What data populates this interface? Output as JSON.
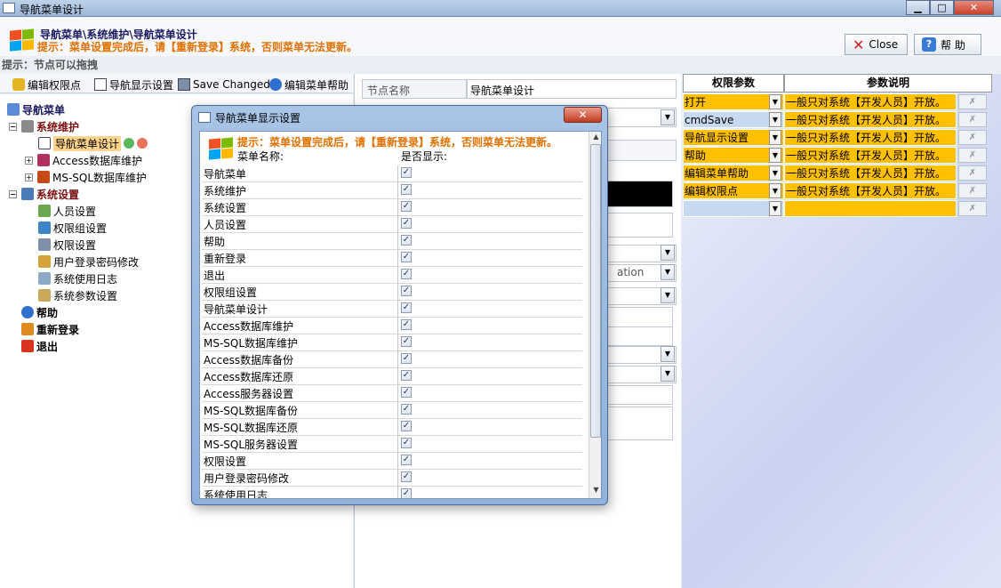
{
  "window": {
    "title": "导航菜单设计",
    "min": "▁",
    "max": "□",
    "close": "✕"
  },
  "header": {
    "path": "导航菜单\\系统维护\\导航菜单设计",
    "note": "提示：菜单设置完成后，请【重新登录】系统，否则菜单无法更新。",
    "close_label": "Close",
    "help_label": "帮  助"
  },
  "hint": "提示：节点可以拖拽",
  "toolbar": {
    "edit_perm": "编辑权限点",
    "nav_display": "导航显示设置",
    "save_changed": "Save Changed",
    "edit_help": "编辑菜单帮助"
  },
  "tree": {
    "root": "导航菜单",
    "sys_maint": "系统维护",
    "nav_design": "导航菜单设计",
    "access_maint": "Access数据库维护",
    "mssql_maint": "MS-SQL数据库维护",
    "sys_settings": "系统设置",
    "user_settings": "人员设置",
    "perm_group": "权限组设置",
    "perm_settings": "权限设置",
    "pwd_change": "用户登录密码修改",
    "sys_log": "系统使用日志",
    "sys_params": "系统参数设置",
    "help": "帮助",
    "relogin": "重新登录",
    "exit": "退出"
  },
  "form": {
    "node_name_label": "节点名称",
    "node_name_value": "导航菜单设计",
    "partial_text": "ation"
  },
  "params": {
    "col1": "权限参数",
    "col2": "参数说明",
    "rows": [
      {
        "param": "打开",
        "desc": "一般只对系统【开发人员】开放。"
      },
      {
        "param": "cmdSave",
        "desc": "一般只对系统【开发人员】开放。"
      },
      {
        "param": "导航显示设置",
        "desc": "一般只对系统【开发人员】开放。"
      },
      {
        "param": "帮助",
        "desc": "一般只对系统【开发人员】开放。"
      },
      {
        "param": "编辑菜单帮助",
        "desc": "一般只对系统【开发人员】开放。"
      },
      {
        "param": "编辑权限点",
        "desc": "一般只对系统【开发人员】开放。"
      },
      {
        "param": "",
        "desc": ""
      }
    ]
  },
  "dialog": {
    "title": "导航菜单显示设置",
    "close": "✕",
    "note": "提示：菜单设置完成后，请【重新登录】系统，否则菜单无法更新。",
    "col_name": "菜单名称:",
    "col_show": "是否显示:",
    "rows": [
      {
        "name": "导航菜单",
        "checked": true
      },
      {
        "name": "系统维护",
        "checked": true
      },
      {
        "name": "系统设置",
        "checked": true
      },
      {
        "name": "人员设置",
        "checked": true
      },
      {
        "name": "帮助",
        "checked": true
      },
      {
        "name": "重新登录",
        "checked": true
      },
      {
        "name": "退出",
        "checked": true
      },
      {
        "name": "权限组设置",
        "checked": true
      },
      {
        "name": "导航菜单设计",
        "checked": true
      },
      {
        "name": "Access数据库维护",
        "checked": true
      },
      {
        "name": "MS-SQL数据库维护",
        "checked": true
      },
      {
        "name": "Access数据库备份",
        "checked": true
      },
      {
        "name": "Access数据库还原",
        "checked": true
      },
      {
        "name": "Access服务器设置",
        "checked": true
      },
      {
        "name": "MS-SQL数据库备份",
        "checked": true
      },
      {
        "name": "MS-SQL数据库还原",
        "checked": true
      },
      {
        "name": "MS-SQL服务器设置",
        "checked": true
      },
      {
        "name": "权限设置",
        "checked": true
      },
      {
        "name": "用户登录密码修改",
        "checked": true
      },
      {
        "name": "系统使用日志",
        "checked": true
      }
    ]
  }
}
